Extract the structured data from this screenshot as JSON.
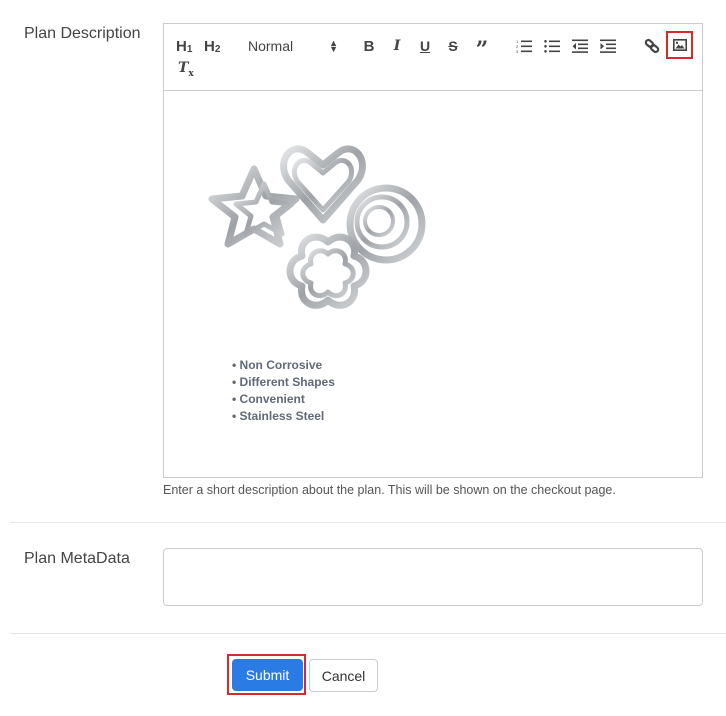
{
  "form": {
    "plan_description_label": "Plan Description",
    "plan_metadata_label": "Plan MetaData",
    "description_help": "Enter a short description about the plan. This will be shown on the checkout page.",
    "metadata_value": ""
  },
  "toolbar": {
    "h1": "H",
    "h1_sub": "1",
    "h2": "H",
    "h2_sub": "2",
    "format_select": "Normal",
    "bold": "B",
    "italic": "I",
    "underline": "U",
    "strike": "S",
    "quote": "”",
    "clear_format": "T",
    "clear_format_sub": "x",
    "highlight_color": "#d9292f"
  },
  "editor": {
    "image_alt": "cookie cutters set",
    "bullets": [
      "Non Corrosive",
      "Different Shapes",
      "Convenient",
      "Stainless Steel"
    ]
  },
  "actions": {
    "submit": "Submit",
    "cancel": "Cancel"
  },
  "colors": {
    "primary": "#2b7be5",
    "highlight": "#d9292f"
  }
}
